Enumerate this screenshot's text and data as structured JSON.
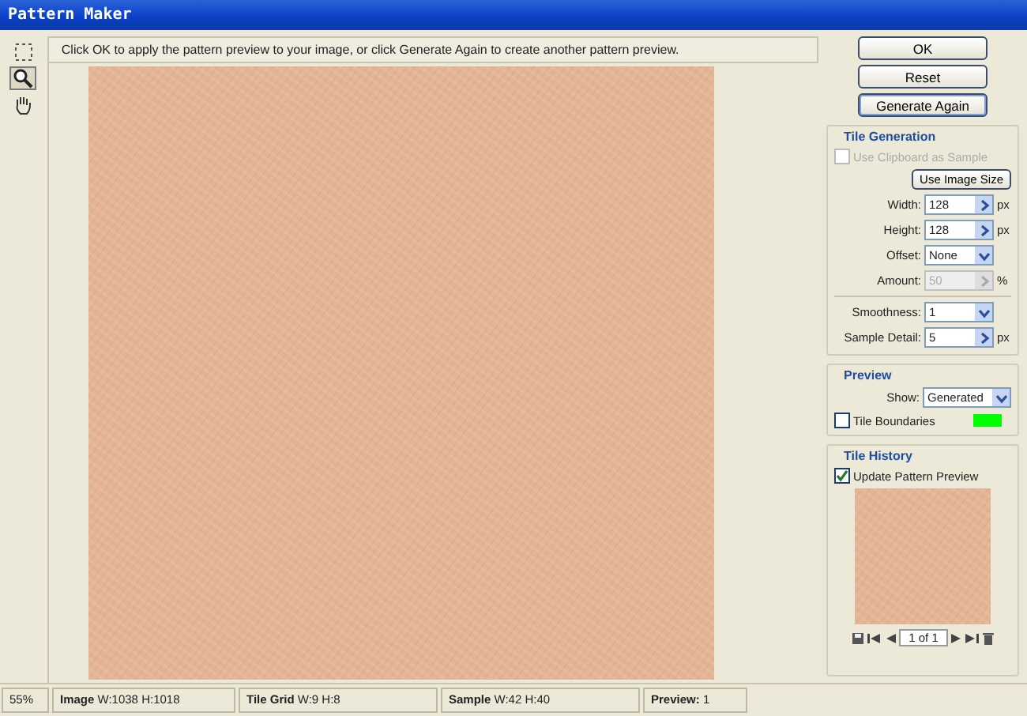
{
  "window": {
    "title": "Pattern Maker"
  },
  "tools": [
    {
      "kind": "marquee",
      "selected": false
    },
    {
      "kind": "zoom",
      "selected": true
    },
    {
      "kind": "hand",
      "selected": false
    }
  ],
  "message": "Click OK to apply the pattern preview to your image, or click Generate Again to create another pattern preview.",
  "buttons": [
    {
      "label": "OK",
      "focused": false
    },
    {
      "label": "Reset",
      "focused": false
    },
    {
      "label": "Generate Again",
      "focused": true
    }
  ],
  "tile_generation": {
    "title": "Tile Generation",
    "use_clipboard": {
      "label": "Use Clipboard as Sample",
      "checked": false,
      "disabled": true
    },
    "use_image_size": "Use Image Size",
    "fields": [
      {
        "kind": "spin",
        "label": "Width:",
        "value": "128",
        "unit": "px",
        "disabled": false
      },
      {
        "kind": "spin",
        "label": "Height:",
        "value": "128",
        "unit": "px",
        "disabled": false
      },
      {
        "kind": "select",
        "label": "Offset:",
        "value": "None",
        "disabled": false
      },
      {
        "kind": "spin",
        "label": "Amount:",
        "value": "50",
        "unit": "%",
        "disabled": true
      }
    ],
    "fields_2": [
      {
        "kind": "select",
        "label": "Smoothness:",
        "value": "1",
        "disabled": false
      },
      {
        "kind": "spin",
        "label": "Sample Detail:",
        "value": "5",
        "unit": "px",
        "disabled": false
      }
    ]
  },
  "preview": {
    "title": "Preview",
    "show": {
      "label": "Show:",
      "value": "Generated"
    },
    "tile_boundaries": {
      "label": "Tile Boundaries",
      "checked": false,
      "color": "#00ff00"
    }
  },
  "tile_history": {
    "title": "Tile History",
    "update": {
      "label": "Update Pattern Preview",
      "checked": true
    },
    "counter": "1 of 1"
  },
  "status_bar": [
    "55%",
    "**Image** W:1038 H:1018",
    "**Tile Grid** W:9 H:8",
    "**Sample** W:42 H:40",
    "**Preview:** 1"
  ]
}
